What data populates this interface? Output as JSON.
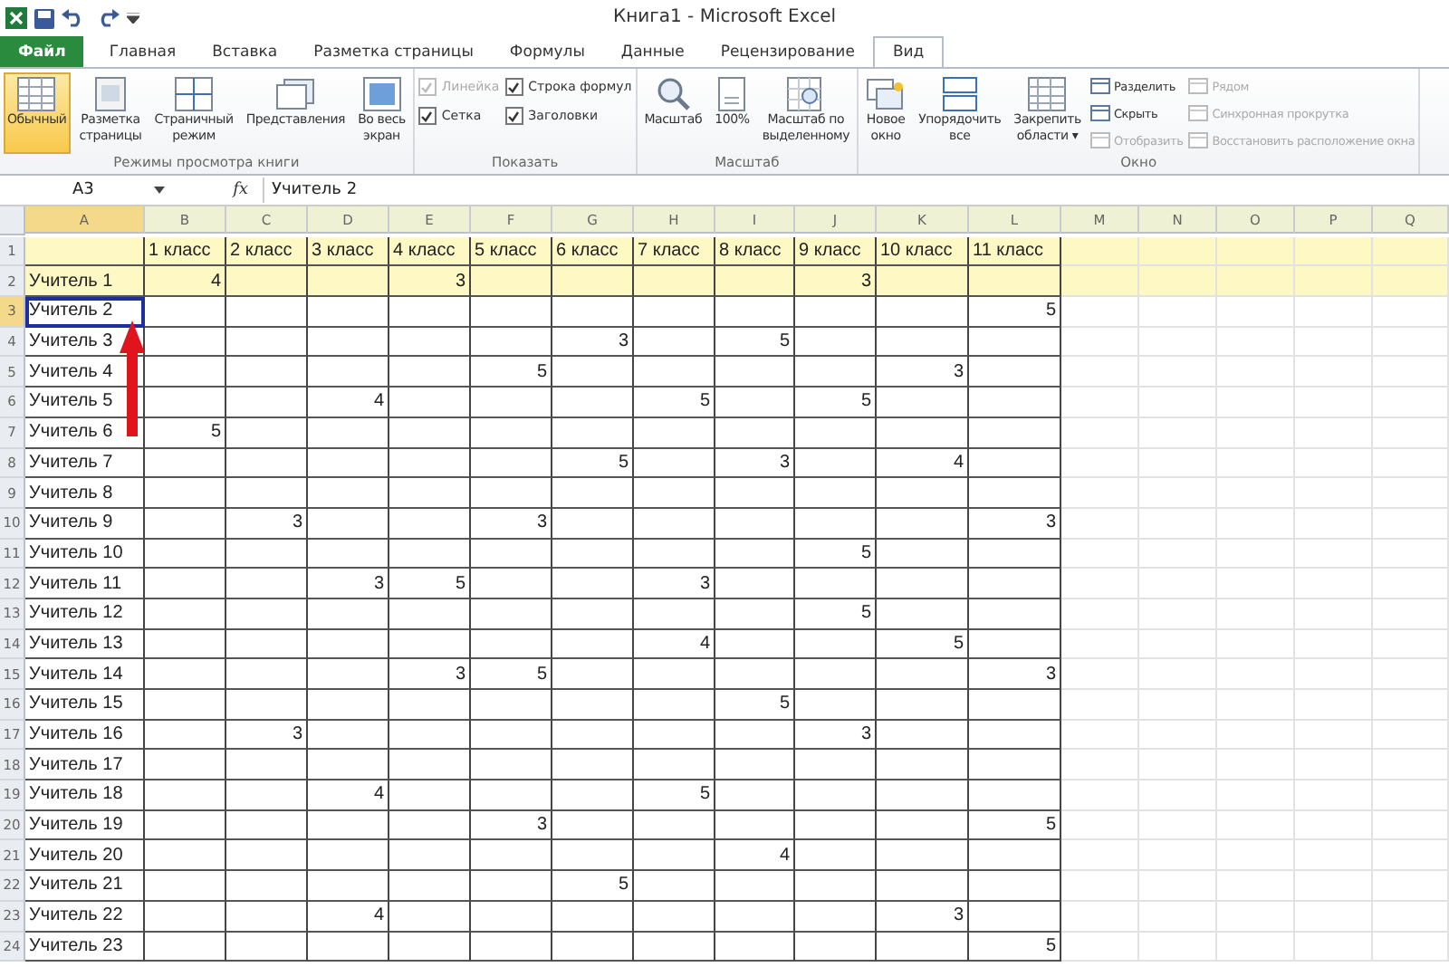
{
  "window": {
    "title": "Книга1  -  Microsoft Excel"
  },
  "tabs": [
    {
      "label": "Файл",
      "kind": "file",
      "selected": false
    },
    {
      "label": "Главная",
      "kind": "tab",
      "selected": false
    },
    {
      "label": "Вставка",
      "kind": "tab",
      "selected": false
    },
    {
      "label": "Разметка страницы",
      "kind": "tab",
      "selected": false
    },
    {
      "label": "Формулы",
      "kind": "tab",
      "selected": false
    },
    {
      "label": "Данные",
      "kind": "tab",
      "selected": false
    },
    {
      "label": "Рецензирование",
      "kind": "tab",
      "selected": false
    },
    {
      "label": "Вид",
      "kind": "tab",
      "selected": true
    }
  ],
  "ribbon": {
    "groups": [
      {
        "label": "Режимы просмотра книги",
        "columns": [
          [
            {
              "kind": "large",
              "label": "Обычный",
              "selected": true,
              "disabled": false
            }
          ],
          [
            {
              "kind": "large",
              "label": "Разметка\nстраницы",
              "selected": false,
              "disabled": false
            }
          ],
          [
            {
              "kind": "large",
              "label": "Страничный\nрежим",
              "selected": false,
              "disabled": false
            }
          ],
          [
            {
              "kind": "large",
              "label": "Представления",
              "selected": false,
              "disabled": false
            }
          ],
          [
            {
              "kind": "large",
              "label": "Во весь\nэкран",
              "selected": false,
              "disabled": false
            }
          ]
        ]
      },
      {
        "label": "Показать",
        "columns": [
          [
            {
              "kind": "check",
              "label": "Линейка",
              "checked": true,
              "disabled": true
            },
            {
              "kind": "check",
              "label": "Сетка",
              "checked": true,
              "disabled": false
            }
          ],
          [
            {
              "kind": "check",
              "label": "Строка формул",
              "checked": true,
              "disabled": false
            },
            {
              "kind": "check",
              "label": "Заголовки",
              "checked": true,
              "disabled": false
            }
          ]
        ]
      },
      {
        "label": "Масштаб",
        "columns": [
          [
            {
              "kind": "large",
              "label": "Масштаб",
              "selected": false,
              "disabled": false
            }
          ],
          [
            {
              "kind": "large",
              "label": "100%",
              "selected": false,
              "disabled": false
            }
          ],
          [
            {
              "kind": "large",
              "label": "Масштаб по\nвыделенному",
              "selected": false,
              "disabled": false
            }
          ]
        ]
      },
      {
        "label": "Окно",
        "columns": [
          [
            {
              "kind": "large",
              "label": "Новое\nокно",
              "selected": false,
              "disabled": false
            }
          ],
          [
            {
              "kind": "large",
              "label": "Упорядочить\nвсе",
              "selected": false,
              "disabled": false
            }
          ],
          [
            {
              "kind": "large",
              "label": "Закрепить\nобласти ▾",
              "selected": false,
              "disabled": false
            }
          ],
          [
            {
              "kind": "small",
              "label": "Разделить",
              "disabled": false
            },
            {
              "kind": "small",
              "label": "Скрыть",
              "disabled": false
            },
            {
              "kind": "small",
              "label": "Отобразить",
              "disabled": true
            }
          ],
          [
            {
              "kind": "small",
              "label": "Рядом",
              "disabled": true
            },
            {
              "kind": "small",
              "label": "Синхронная прокрутка",
              "disabled": true
            },
            {
              "kind": "small",
              "label": "Восстановить расположение окна",
              "disabled": true
            }
          ]
        ]
      }
    ]
  },
  "formula_bar": {
    "name_box": "A3",
    "fx": "fx",
    "value": "Учитель 2"
  },
  "sheet": {
    "columns": [
      {
        "label": "A",
        "selected": true
      },
      {
        "label": "B",
        "selected": false
      },
      {
        "label": "C",
        "selected": false
      },
      {
        "label": "D",
        "selected": false
      },
      {
        "label": "E",
        "selected": false
      },
      {
        "label": "F",
        "selected": false
      },
      {
        "label": "G",
        "selected": false
      },
      {
        "label": "H",
        "selected": false
      },
      {
        "label": "I",
        "selected": false
      },
      {
        "label": "J",
        "selected": false
      },
      {
        "label": "K",
        "selected": false
      },
      {
        "label": "L",
        "selected": false
      },
      {
        "label": "M",
        "selected": false
      },
      {
        "label": "N",
        "selected": false
      },
      {
        "label": "O",
        "selected": false
      },
      {
        "label": "P",
        "selected": false
      },
      {
        "label": "Q",
        "selected": false
      }
    ],
    "rows": [
      {
        "header": "1",
        "highlighted": true,
        "selected": false,
        "cells": [
          null,
          "1 класс",
          "2 класс",
          "3 класс",
          "4 класс",
          "5 класс",
          "6 класс",
          "7 класс",
          "8 класс",
          "9 класс",
          "10 класс",
          "11 класс"
        ]
      },
      {
        "header": "2",
        "highlighted": true,
        "selected": false,
        "cells": [
          "Учитель 1",
          "4",
          null,
          null,
          "3",
          null,
          null,
          null,
          null,
          "3",
          null,
          null
        ]
      },
      {
        "header": "3",
        "highlighted": false,
        "selected": true,
        "cells": [
          "Учитель 2",
          null,
          null,
          null,
          null,
          null,
          null,
          null,
          null,
          null,
          null,
          "5"
        ]
      },
      {
        "header": "4",
        "highlighted": false,
        "selected": false,
        "cells": [
          "Учитель 3",
          null,
          null,
          null,
          null,
          null,
          "3",
          null,
          "5",
          null,
          null,
          null
        ]
      },
      {
        "header": "5",
        "highlighted": false,
        "selected": false,
        "cells": [
          "Учитель 4",
          null,
          null,
          null,
          null,
          "5",
          null,
          null,
          null,
          null,
          "3",
          null
        ]
      },
      {
        "header": "6",
        "highlighted": false,
        "selected": false,
        "cells": [
          "Учитель 5",
          null,
          null,
          "4",
          null,
          null,
          null,
          "5",
          null,
          "5",
          null,
          null
        ]
      },
      {
        "header": "7",
        "highlighted": false,
        "selected": false,
        "cells": [
          "Учитель 6",
          "5",
          null,
          null,
          null,
          null,
          null,
          null,
          null,
          null,
          null,
          null
        ]
      },
      {
        "header": "8",
        "highlighted": false,
        "selected": false,
        "cells": [
          "Учитель 7",
          null,
          null,
          null,
          null,
          null,
          "5",
          null,
          "3",
          null,
          "4",
          null
        ]
      },
      {
        "header": "9",
        "highlighted": false,
        "selected": false,
        "cells": [
          "Учитель 8",
          null,
          null,
          null,
          null,
          null,
          null,
          null,
          null,
          null,
          null,
          null
        ]
      },
      {
        "header": "10",
        "highlighted": false,
        "selected": false,
        "cells": [
          "Учитель 9",
          null,
          "3",
          null,
          null,
          "3",
          null,
          null,
          null,
          null,
          null,
          "3"
        ]
      },
      {
        "header": "11",
        "highlighted": false,
        "selected": false,
        "cells": [
          "Учитель 10",
          null,
          null,
          null,
          null,
          null,
          null,
          null,
          null,
          "5",
          null,
          null
        ]
      },
      {
        "header": "12",
        "highlighted": false,
        "selected": false,
        "cells": [
          "Учитель 11",
          null,
          null,
          "3",
          "5",
          null,
          null,
          "3",
          null,
          null,
          null,
          null
        ]
      },
      {
        "header": "13",
        "highlighted": false,
        "selected": false,
        "cells": [
          "Учитель 12",
          null,
          null,
          null,
          null,
          null,
          null,
          null,
          null,
          "5",
          null,
          null
        ]
      },
      {
        "header": "14",
        "highlighted": false,
        "selected": false,
        "cells": [
          "Учитель 13",
          null,
          null,
          null,
          null,
          null,
          null,
          "4",
          null,
          null,
          "5",
          null
        ]
      },
      {
        "header": "15",
        "highlighted": false,
        "selected": false,
        "cells": [
          "Учитель 14",
          null,
          null,
          null,
          "3",
          "5",
          null,
          null,
          null,
          null,
          null,
          "3"
        ]
      },
      {
        "header": "16",
        "highlighted": false,
        "selected": false,
        "cells": [
          "Учитель 15",
          null,
          null,
          null,
          null,
          null,
          null,
          null,
          "5",
          null,
          null,
          null
        ]
      },
      {
        "header": "17",
        "highlighted": false,
        "selected": false,
        "cells": [
          "Учитель 16",
          null,
          "3",
          null,
          null,
          null,
          null,
          null,
          null,
          "3",
          null,
          null
        ]
      },
      {
        "header": "18",
        "highlighted": false,
        "selected": false,
        "cells": [
          "Учитель 17",
          null,
          null,
          null,
          null,
          null,
          null,
          null,
          null,
          null,
          null,
          null
        ]
      },
      {
        "header": "19",
        "highlighted": false,
        "selected": false,
        "cells": [
          "Учитель 18",
          null,
          null,
          "4",
          null,
          null,
          null,
          "5",
          null,
          null,
          null,
          null
        ]
      },
      {
        "header": "20",
        "highlighted": false,
        "selected": false,
        "cells": [
          "Учитель 19",
          null,
          null,
          null,
          null,
          "3",
          null,
          null,
          null,
          null,
          null,
          "5"
        ]
      },
      {
        "header": "21",
        "highlighted": false,
        "selected": false,
        "cells": [
          "Учитель 20",
          null,
          null,
          null,
          null,
          null,
          null,
          null,
          "4",
          null,
          null,
          null
        ]
      },
      {
        "header": "22",
        "highlighted": false,
        "selected": false,
        "cells": [
          "Учитель 21",
          null,
          null,
          null,
          null,
          null,
          "5",
          null,
          null,
          null,
          null,
          null
        ]
      },
      {
        "header": "23",
        "highlighted": false,
        "selected": false,
        "cells": [
          "Учитель 22",
          null,
          null,
          "4",
          null,
          null,
          null,
          null,
          null,
          null,
          "3",
          null
        ]
      },
      {
        "header": "24",
        "highlighted": false,
        "selected": false,
        "cells": [
          "Учитель 23",
          null,
          null,
          null,
          null,
          null,
          null,
          null,
          null,
          null,
          null,
          "5"
        ]
      }
    ]
  }
}
